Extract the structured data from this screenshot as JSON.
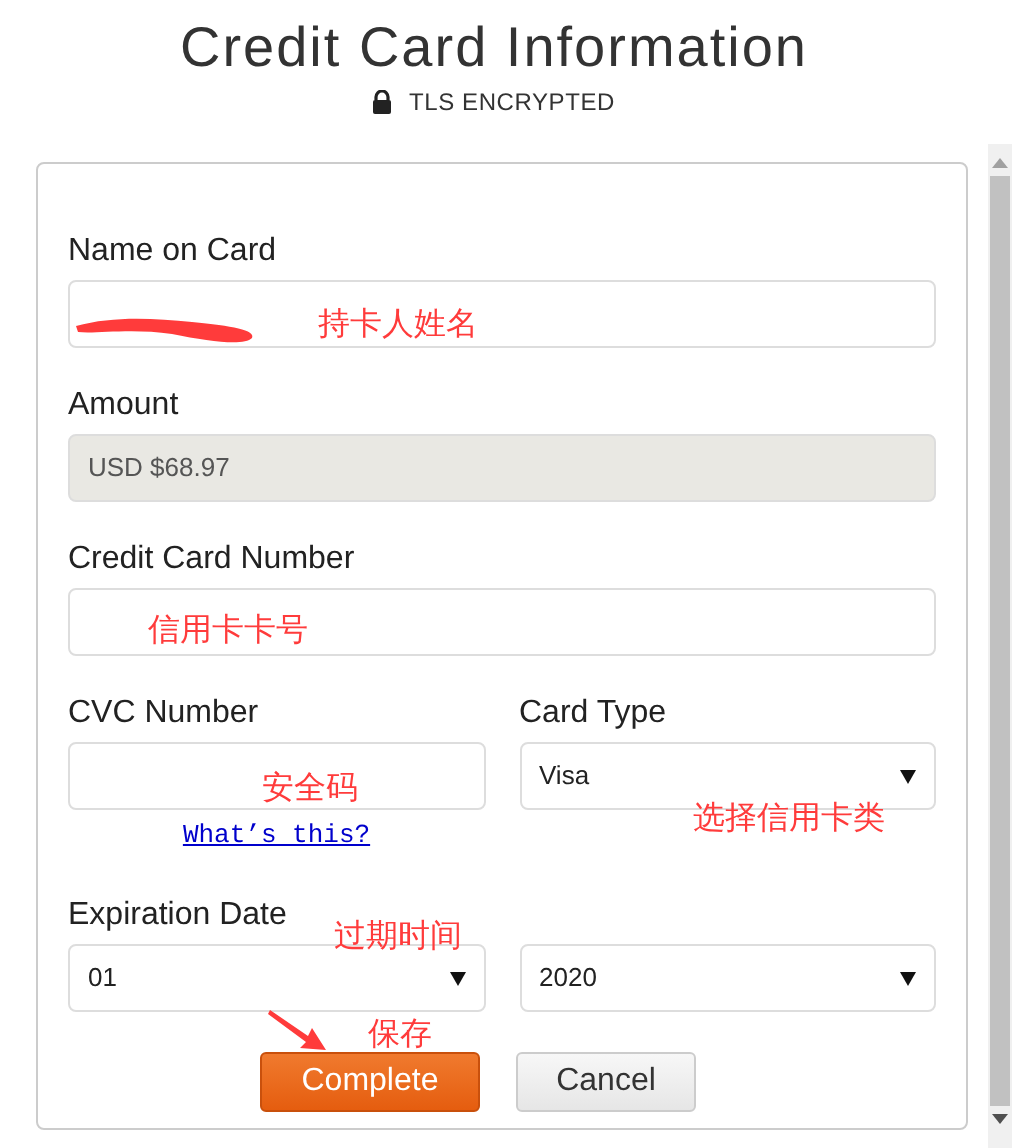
{
  "header": {
    "title": "Credit Card Information",
    "subtitle": "TLS ENCRYPTED"
  },
  "form": {
    "rows": [
      [
        {
          "kind": "text",
          "label": "Name on Card",
          "redacted": true,
          "note": "持卡人姓名"
        }
      ],
      [
        {
          "kind": "readonly",
          "label": "Amount",
          "value": "USD $68.97"
        }
      ],
      [
        {
          "kind": "text",
          "label": "Credit Card Number",
          "note": "信用卡卡号"
        }
      ],
      [
        {
          "kind": "text",
          "label": "CVC Number",
          "note": "安全码",
          "help_link": "What’s this?"
        },
        {
          "kind": "select",
          "label": "Card Type",
          "value": "Visa",
          "note": "选择信用卡类"
        }
      ],
      [
        {
          "kind": "select",
          "label": "Expiration Date",
          "value": "01",
          "note": "过期时间"
        },
        {
          "kind": "select",
          "value": "2020"
        }
      ]
    ],
    "buttons": [
      {
        "kind": "primary",
        "label": "Complete",
        "note": "保存",
        "arrow": true
      },
      {
        "kind": "secondary",
        "label": "Cancel"
      }
    ]
  }
}
